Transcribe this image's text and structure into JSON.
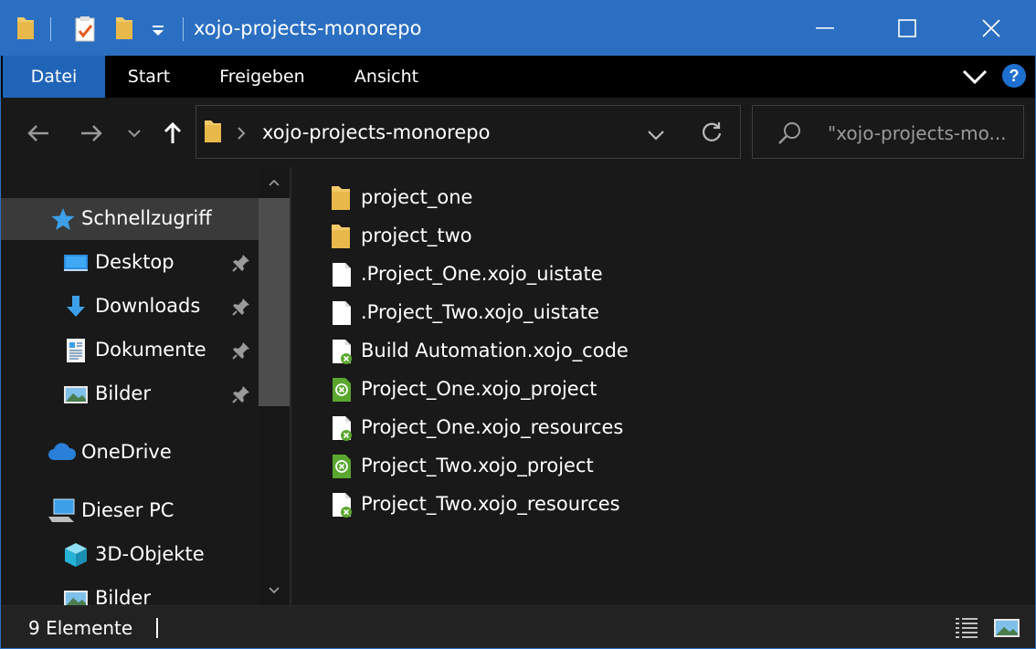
{
  "window": {
    "title": "xojo-projects-monorepo"
  },
  "colors": {
    "accent": "#2b6fc2",
    "ribbon_active": "#2064b8",
    "folder": "#f3c969",
    "xojo_green": "#5aa72f"
  },
  "ribbon": {
    "tabs": [
      {
        "label": "Datei",
        "active": true
      },
      {
        "label": "Start"
      },
      {
        "label": "Freigeben"
      },
      {
        "label": "Ansicht"
      }
    ]
  },
  "address": {
    "path_segment": "xojo-projects-monorepo"
  },
  "search": {
    "placeholder": "\"xojo-projects-mo..."
  },
  "nav": {
    "items": [
      {
        "label": "Schnellzugriff",
        "icon": "star-icon"
      },
      {
        "label": "Desktop",
        "icon": "desktop-icon",
        "pinned": true
      },
      {
        "label": "Downloads",
        "icon": "download-icon",
        "pinned": true
      },
      {
        "label": "Dokumente",
        "icon": "document-icon",
        "pinned": true
      },
      {
        "label": "Bilder",
        "icon": "pictures-icon",
        "pinned": true
      },
      {
        "label": "OneDrive",
        "icon": "cloud-icon"
      },
      {
        "label": "Dieser PC",
        "icon": "computer-icon"
      },
      {
        "label": "3D-Objekte",
        "icon": "3d-objects-icon"
      },
      {
        "label": "Bilder",
        "icon": "pictures-icon"
      }
    ]
  },
  "files": [
    {
      "name": "project_one",
      "icon": "folder-icon"
    },
    {
      "name": "project_two",
      "icon": "folder-icon"
    },
    {
      "name": ".Project_One.xojo_uistate",
      "icon": "blank-file-icon"
    },
    {
      "name": ".Project_Two.xojo_uistate",
      "icon": "blank-file-icon"
    },
    {
      "name": "Build Automation.xojo_code",
      "icon": "xojo-file-icon"
    },
    {
      "name": "Project_One.xojo_project",
      "icon": "xojo-project-icon"
    },
    {
      "name": "Project_One.xojo_resources",
      "icon": "xojo-file-icon"
    },
    {
      "name": "Project_Two.xojo_project",
      "icon": "xojo-project-icon"
    },
    {
      "name": "Project_Two.xojo_resources",
      "icon": "xojo-file-icon"
    }
  ],
  "status": {
    "count_text": "9 Elemente"
  }
}
